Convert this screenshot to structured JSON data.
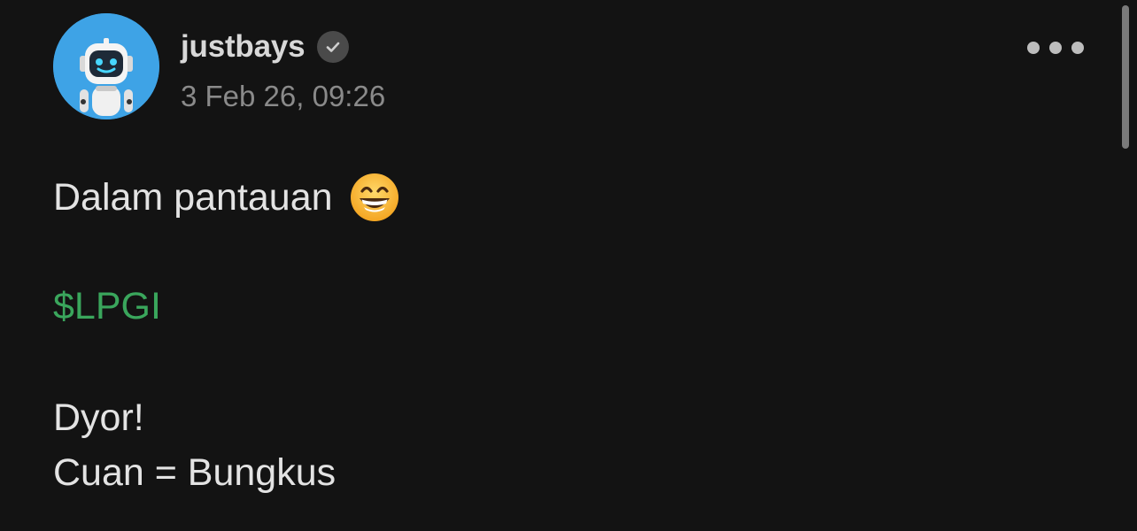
{
  "post": {
    "author": {
      "username": "justbays",
      "verified": true,
      "avatar_icon": "robot-avatar-icon"
    },
    "timestamp": "3 Feb 26, 09:26",
    "menu_icon": "more-options-icon",
    "content": {
      "line1_text": "Dalam pantauan",
      "line1_emoji": "grinning-face-with-smiling-eyes",
      "ticker": "$LPGI",
      "line3": "Dyor!",
      "line4": "Cuan = Bungkus"
    }
  },
  "colors": {
    "background": "#131313",
    "text": "#e3e3e3",
    "muted": "#8a8a8a",
    "ticker": "#3aa65c",
    "avatar_bg": "#3ea3e6"
  }
}
